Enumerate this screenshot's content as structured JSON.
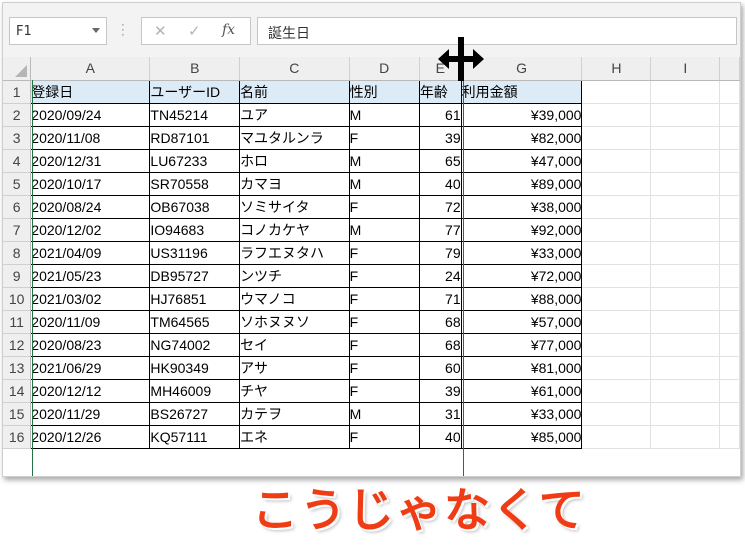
{
  "formula_bar": {
    "name_box": "F1",
    "cancel_glyph": "✕",
    "enter_glyph": "✓",
    "fx_glyph": "fx",
    "formula_value": "誕生日"
  },
  "columns": [
    "A",
    "B",
    "C",
    "D",
    "E",
    "G",
    "H",
    "I"
  ],
  "table_header": {
    "row_num": "1",
    "cells": [
      "登録日",
      "ユーザーID",
      "名前",
      "性別",
      "年齢",
      "利用金額"
    ]
  },
  "rows": [
    {
      "n": "2",
      "c": [
        "2020/09/24",
        "TN45214",
        "ユア",
        "M",
        "61",
        "¥39,000"
      ]
    },
    {
      "n": "3",
      "c": [
        "2020/11/08",
        "RD87101",
        "マユタルンラ",
        "F",
        "39",
        "¥82,000"
      ]
    },
    {
      "n": "4",
      "c": [
        "2020/12/31",
        "LU67233",
        "ホロ",
        "M",
        "65",
        "¥47,000"
      ]
    },
    {
      "n": "5",
      "c": [
        "2020/10/17",
        "SR70558",
        "カマヨ",
        "M",
        "40",
        "¥89,000"
      ]
    },
    {
      "n": "6",
      "c": [
        "2020/08/24",
        "OB67038",
        "ソミサイタ",
        "F",
        "72",
        "¥38,000"
      ]
    },
    {
      "n": "7",
      "c": [
        "2020/12/02",
        "IO94683",
        "コノカケヤ",
        "M",
        "77",
        "¥92,000"
      ]
    },
    {
      "n": "8",
      "c": [
        "2021/04/09",
        "US31196",
        "ラフエヌタハ",
        "F",
        "79",
        "¥33,000"
      ]
    },
    {
      "n": "9",
      "c": [
        "2021/05/23",
        "DB95727",
        "ンツチ",
        "F",
        "24",
        "¥72,000"
      ]
    },
    {
      "n": "10",
      "c": [
        "2021/03/02",
        "HJ76851",
        "ウマノコ",
        "F",
        "71",
        "¥88,000"
      ]
    },
    {
      "n": "11",
      "c": [
        "2020/11/09",
        "TM64565",
        "ソホヌヌソ",
        "F",
        "68",
        "¥57,000"
      ]
    },
    {
      "n": "12",
      "c": [
        "2020/08/23",
        "NG74002",
        "セイ",
        "F",
        "68",
        "¥77,000"
      ]
    },
    {
      "n": "13",
      "c": [
        "2021/06/29",
        "HK90349",
        "アサ",
        "F",
        "60",
        "¥81,000"
      ]
    },
    {
      "n": "14",
      "c": [
        "2020/12/12",
        "MH46009",
        "チヤ",
        "F",
        "39",
        "¥61,000"
      ]
    },
    {
      "n": "15",
      "c": [
        "2020/11/29",
        "BS26727",
        "カテヲ",
        "M",
        "31",
        "¥33,000"
      ]
    },
    {
      "n": "16",
      "c": [
        "2020/12/26",
        "KQ57111",
        "エネ",
        "F",
        "40",
        "¥85,000"
      ]
    }
  ],
  "caption": "こうじゃなくて",
  "colors": {
    "header_fill": "#ddebf7",
    "caption": "#f03c14",
    "selection": "#217346"
  },
  "icons": [
    "name-box-dropdown-icon",
    "cancel-icon",
    "enter-icon",
    "function-icon",
    "resize-cursor-icon"
  ]
}
